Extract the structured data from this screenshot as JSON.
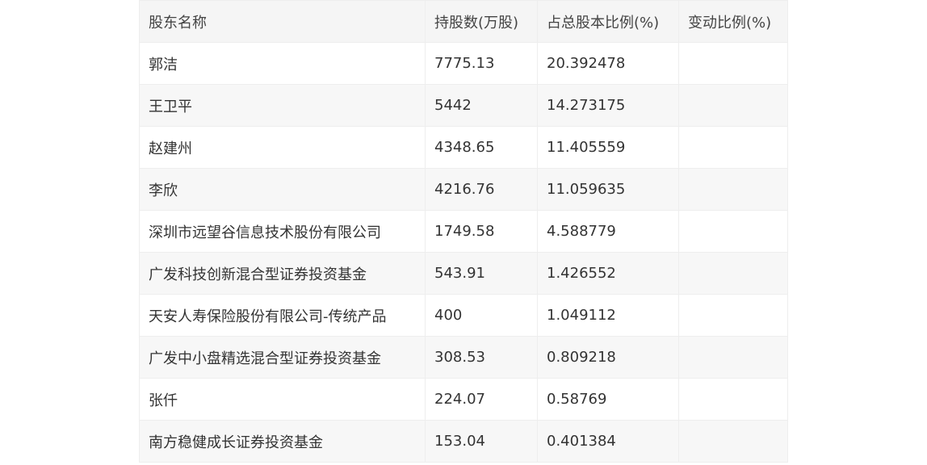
{
  "table": {
    "headers": [
      "股东名称",
      "持股数(万股)",
      "占总股本比例(%)",
      "变动比例(%)"
    ],
    "rows": [
      [
        "郭洁",
        "7775.13",
        "20.392478",
        ""
      ],
      [
        "王卫平",
        "5442",
        "14.273175",
        ""
      ],
      [
        "赵建州",
        "4348.65",
        "11.405559",
        ""
      ],
      [
        "李欣",
        "4216.76",
        "11.059635",
        ""
      ],
      [
        "深圳市远望谷信息技术股份有限公司",
        "1749.58",
        "4.588779",
        ""
      ],
      [
        "广发科技创新混合型证券投资基金",
        "543.91",
        "1.426552",
        ""
      ],
      [
        "天安人寿保险股份有限公司-传统产品",
        "400",
        "1.049112",
        ""
      ],
      [
        "广发中小盘精选混合型证券投资基金",
        "308.53",
        "0.809218",
        ""
      ],
      [
        "张仟",
        "224.07",
        "0.58769",
        ""
      ],
      [
        "南方稳健成长证券投资基金",
        "153.04",
        "0.401384",
        ""
      ]
    ]
  }
}
